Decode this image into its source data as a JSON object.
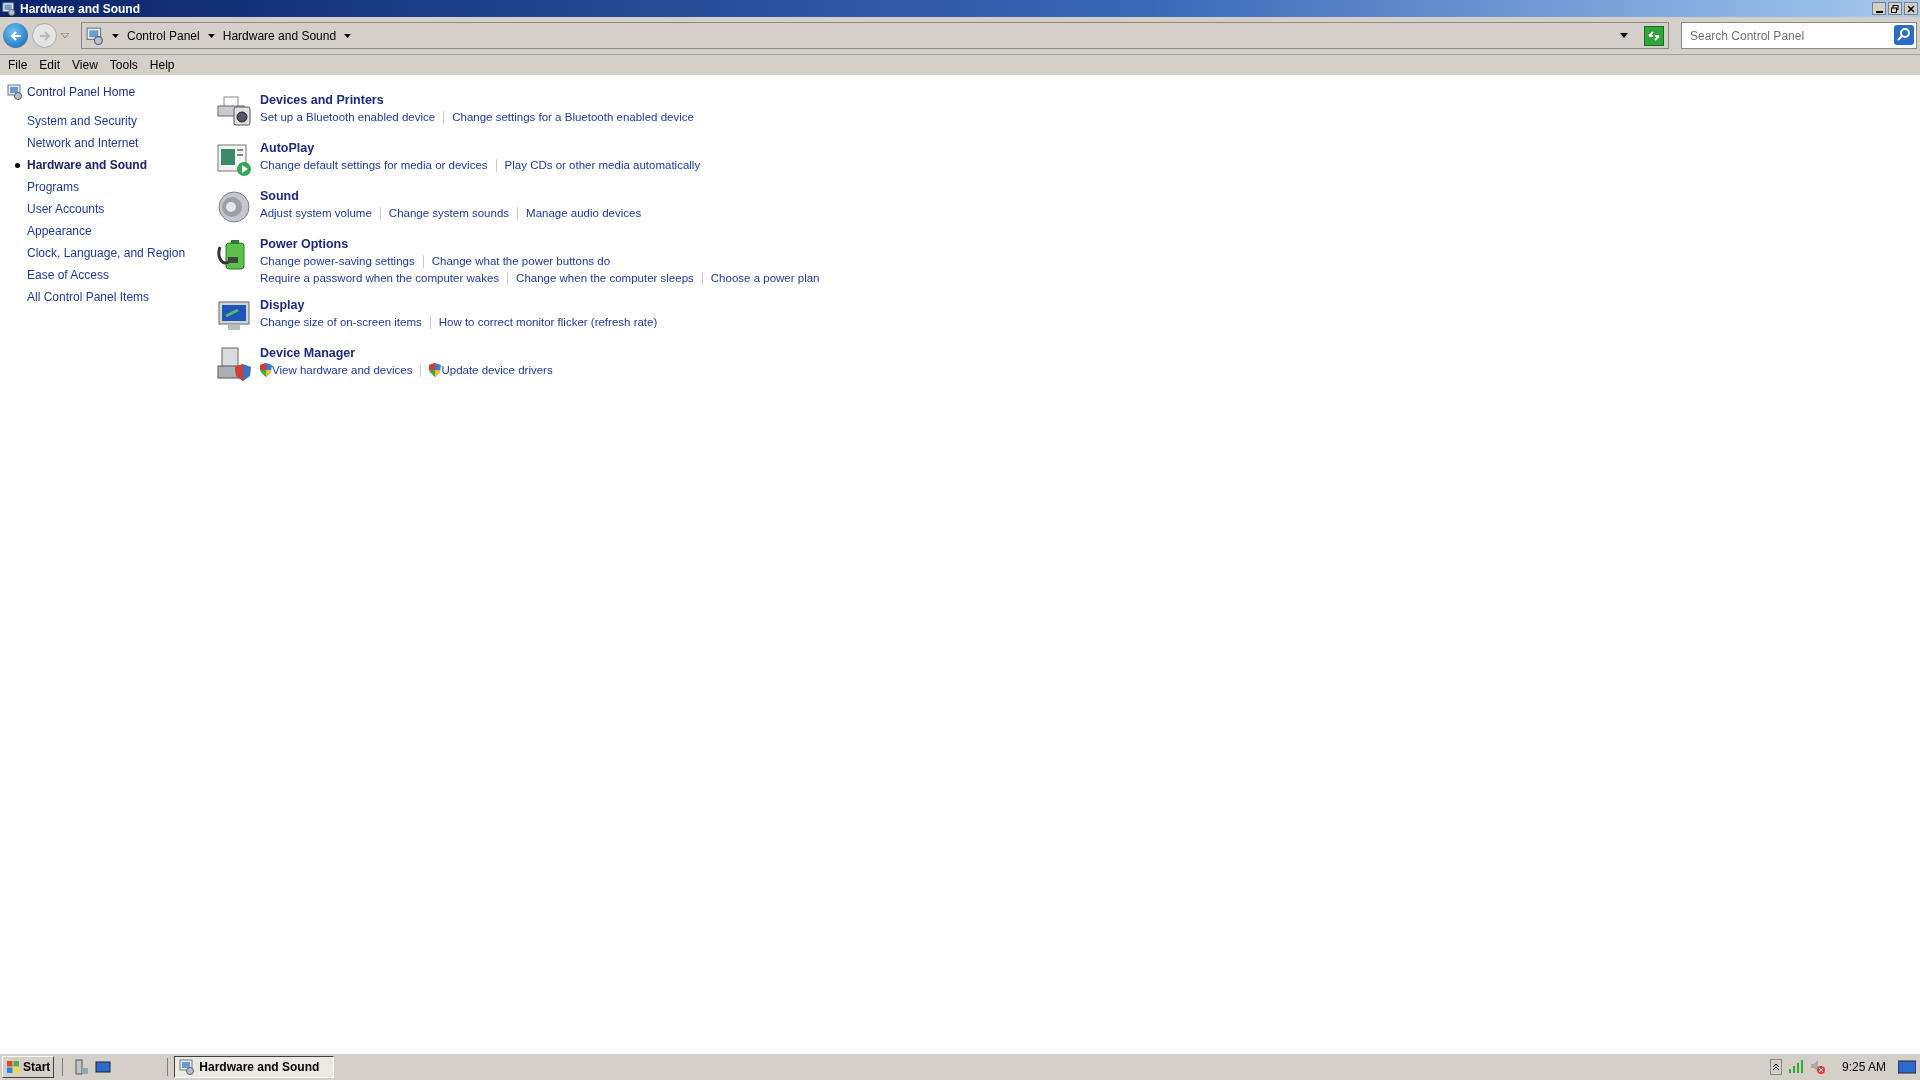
{
  "window": {
    "title": "Hardware and Sound"
  },
  "address_bar": {
    "breadcrumbs": [
      "Control Panel",
      "Hardware and Sound"
    ]
  },
  "search": {
    "placeholder": "Search Control Panel"
  },
  "menu": [
    "File",
    "Edit",
    "View",
    "Tools",
    "Help"
  ],
  "sidebar": {
    "home": "Control Panel Home",
    "items": [
      {
        "label": "System and Security",
        "selected": false
      },
      {
        "label": "Network and Internet",
        "selected": false
      },
      {
        "label": "Hardware and Sound",
        "selected": true
      },
      {
        "label": "Programs",
        "selected": false
      },
      {
        "label": "User Accounts",
        "selected": false
      },
      {
        "label": "Appearance",
        "selected": false
      },
      {
        "label": "Clock, Language, and Region",
        "selected": false
      },
      {
        "label": "Ease of Access",
        "selected": false
      },
      {
        "label": "All Control Panel Items",
        "selected": false
      }
    ]
  },
  "categories": [
    {
      "kind": "printer",
      "title": "Devices and Printers",
      "link_rows": [
        [
          {
            "text": "Set up a Bluetooth enabled device",
            "shield": false
          },
          {
            "text": "Change settings for a Bluetooth enabled device",
            "shield": false
          }
        ]
      ]
    },
    {
      "kind": "autoplay",
      "title": "AutoPlay",
      "link_rows": [
        [
          {
            "text": "Change default settings for media or devices",
            "shield": false
          },
          {
            "text": "Play CDs or other media automatically",
            "shield": false
          }
        ]
      ]
    },
    {
      "kind": "speaker",
      "title": "Sound",
      "link_rows": [
        [
          {
            "text": "Adjust system volume",
            "shield": false
          },
          {
            "text": "Change system sounds",
            "shield": false
          },
          {
            "text": "Manage audio devices",
            "shield": false
          }
        ]
      ]
    },
    {
      "kind": "power",
      "title": "Power Options",
      "link_rows": [
        [
          {
            "text": "Change power-saving settings",
            "shield": false
          },
          {
            "text": "Change what the power buttons do",
            "shield": false
          }
        ],
        [
          {
            "text": "Require a password when the computer wakes",
            "shield": false
          },
          {
            "text": "Change when the computer sleeps",
            "shield": false
          },
          {
            "text": "Choose a power plan",
            "shield": false
          }
        ]
      ]
    },
    {
      "kind": "monitor",
      "title": "Display",
      "link_rows": [
        [
          {
            "text": "Change size of on-screen items",
            "shield": false
          },
          {
            "text": "How to correct monitor flicker (refresh rate)",
            "shield": false
          }
        ]
      ]
    },
    {
      "kind": "device-manager",
      "title": "Device Manager",
      "link_rows": [
        [
          {
            "text": "View hardware and devices",
            "shield": true
          },
          {
            "text": "Update device drivers",
            "shield": true
          }
        ]
      ]
    }
  ],
  "taskbar": {
    "start": "Start",
    "tasks": [
      {
        "label": "Hardware and Sound",
        "selected": true
      }
    ],
    "clock": "9:25 AM"
  }
}
